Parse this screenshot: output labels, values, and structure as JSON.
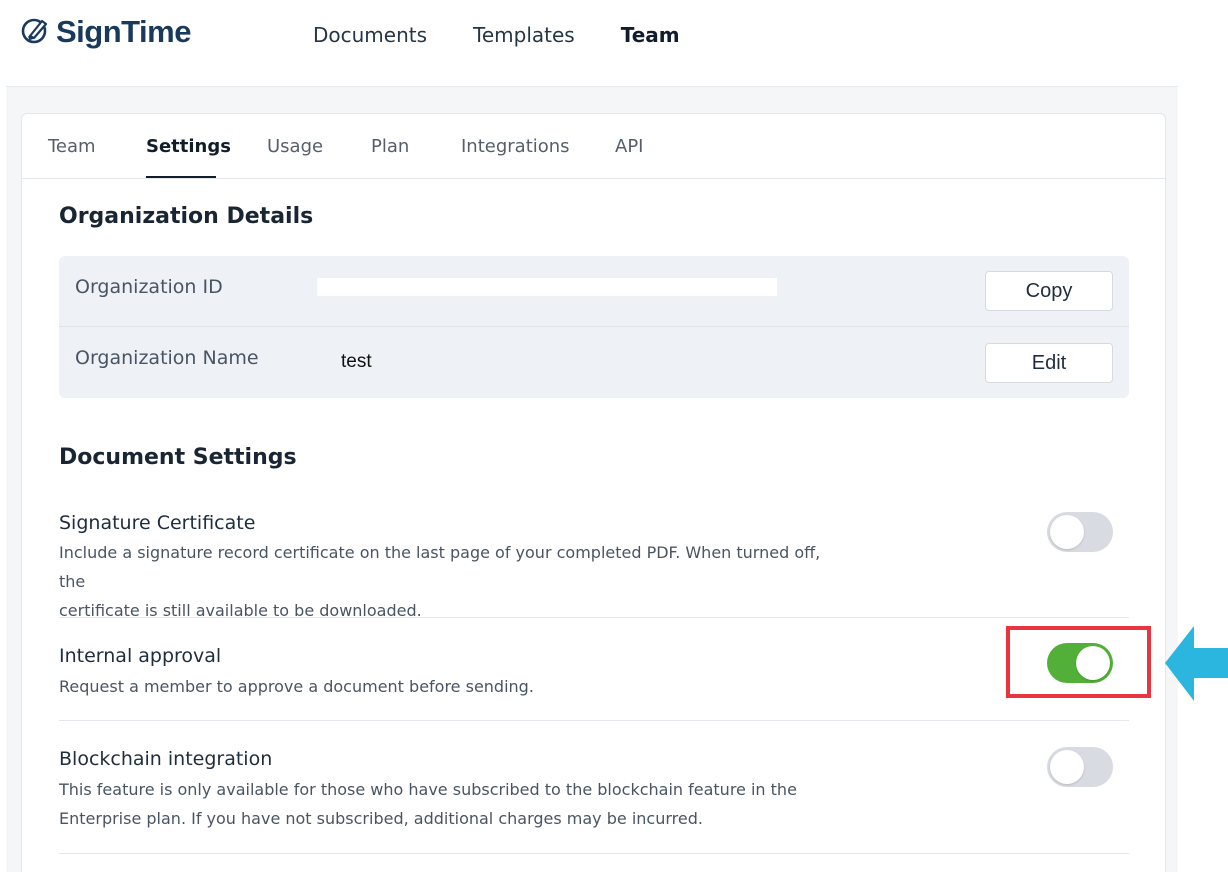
{
  "app": {
    "name": "SignTime"
  },
  "topnav": {
    "items": [
      {
        "label": "Documents",
        "active": false
      },
      {
        "label": "Templates",
        "active": false
      },
      {
        "label": "Team",
        "active": true
      }
    ]
  },
  "tabs": [
    {
      "label": "Team",
      "active": false
    },
    {
      "label": "Settings",
      "active": true
    },
    {
      "label": "Usage",
      "active": false
    },
    {
      "label": "Plan",
      "active": false
    },
    {
      "label": "Integrations",
      "active": false
    },
    {
      "label": "API",
      "active": false
    }
  ],
  "organization": {
    "heading": "Organization Details",
    "id_label": "Organization ID",
    "id_value": "",
    "copy_button": "Copy",
    "name_label": "Organization Name",
    "name_value": "test",
    "edit_button": "Edit"
  },
  "document_settings": {
    "heading": "Document Settings",
    "items": [
      {
        "title": "Signature Certificate",
        "description_lines": [
          "Include a signature record certificate on the last page of your completed PDF. When turned off, the",
          "certificate is still available to be downloaded."
        ],
        "enabled": false
      },
      {
        "title": "Internal approval",
        "description_lines": [
          "Request a member to approve a document before sending."
        ],
        "enabled": true
      },
      {
        "title": "Blockchain integration",
        "description_lines": [
          "This feature is only available for those who have subscribed to the blockchain feature in the",
          "Enterprise plan. If you have not subscribed, additional charges may be incurred."
        ],
        "enabled": false
      }
    ]
  },
  "annotation": {
    "highlight_color": "#e8353f",
    "arrow_color": "#2bb6e0"
  },
  "colors": {
    "toggle_on": "#52b038",
    "toggle_off": "#d8dbe1",
    "brand": "#1a3a5c"
  }
}
